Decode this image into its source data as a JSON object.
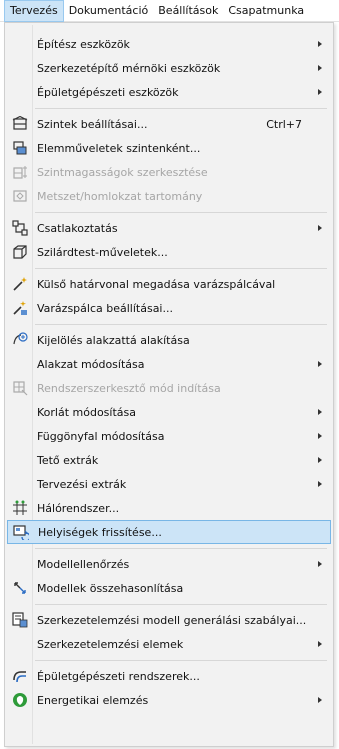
{
  "menubar": {
    "items": [
      "Tervezés",
      "Dokumentáció",
      "Beállítások",
      "Csapatmunka"
    ]
  },
  "menu": {
    "items": [
      {
        "label": "Építész eszközök",
        "submenu": true
      },
      {
        "label": "Szerkezetépítő mérnöki eszközök",
        "submenu": true
      },
      {
        "label": "Épületgépészeti eszközök",
        "submenu": true
      },
      {
        "label": "Szintek beállításai...",
        "shortcut": "Ctrl+7",
        "icon": "story-settings-icon"
      },
      {
        "label": "Elemműveletek szintenként...",
        "icon": "story-operations-icon"
      },
      {
        "label": "Szintmagasságok szerkesztése",
        "disabled": true,
        "icon": "story-levels-icon"
      },
      {
        "label": "Metszet/homlokzat tartomány",
        "disabled": true,
        "icon": "section-range-icon"
      },
      {
        "label": "Csatlakoztatás",
        "submenu": true,
        "icon": "connect-icon"
      },
      {
        "label": "Szilárdtest-műveletek...",
        "icon": "solid-operations-icon"
      },
      {
        "label": "Külső határvonal megadása varázspálcával",
        "icon": "magic-wand-icon"
      },
      {
        "label": "Varázspálca beállításai...",
        "icon": "magic-wand-settings-icon"
      },
      {
        "label": "Kijelölés alakzattá alakítása",
        "icon": "convert-to-morph-icon"
      },
      {
        "label": "Alakzat módosítása",
        "submenu": true
      },
      {
        "label": "Rendszerszerkesztő mód indítása",
        "disabled": true,
        "icon": "system-edit-icon"
      },
      {
        "label": "Korlát módosítása",
        "submenu": true
      },
      {
        "label": "Függönyfal módosítása",
        "submenu": true
      },
      {
        "label": "Tető extrák",
        "submenu": true
      },
      {
        "label": "Tervezési extrák",
        "submenu": true
      },
      {
        "label": "Hálórendszer...",
        "icon": "grid-system-icon"
      },
      {
        "label": "Helyiségek frissítése...",
        "selected": true,
        "icon": "update-zones-icon"
      },
      {
        "label": "Modellellenőrzés",
        "submenu": true
      },
      {
        "label": "Modellek összehasonlítása",
        "icon": "compare-models-icon"
      },
      {
        "label": "Szerkezetelemzési modell generálási szabályai...",
        "icon": "analytical-model-icon"
      },
      {
        "label": "Szerkezetelemzési elemek",
        "submenu": true
      },
      {
        "label": "Épületgépészeti rendszerek...",
        "icon": "mep-systems-icon"
      },
      {
        "label": "Energetikai elemzés",
        "submenu": true,
        "icon": "energy-evaluation-icon"
      }
    ]
  },
  "colors": {
    "selection_bg": "#cce4f7",
    "selection_border": "#78b6e6",
    "disabled_text": "#a6a6a6",
    "menu_bg": "#f2f2f2"
  }
}
